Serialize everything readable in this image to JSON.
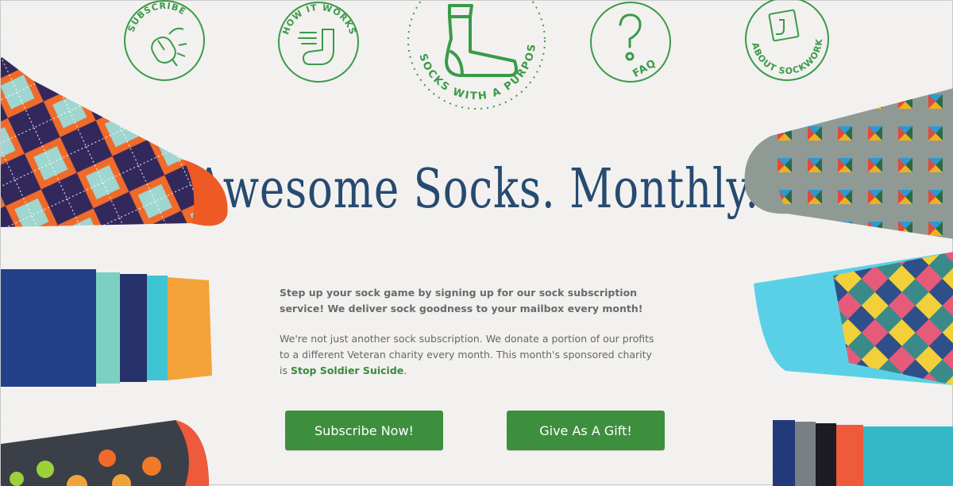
{
  "nav": {
    "subscribe": "SUBSCRIBE",
    "how_it_works": "HOW IT WORKS",
    "logo_tagline": "SOCKS WITH A PURPOSE",
    "faq": "FAQ",
    "about": "ABOUT SOCKWORK"
  },
  "hero": {
    "title": "Awesome Socks. Monthly.",
    "intro": "Step up your sock game by signing up for our sock subscription service! We deliver sock goodness to your mailbox every month!",
    "mission_before": "We're not just another sock subscription. We donate a portion of our profits to a different Veteran charity every month. This month's sponsored charity is ",
    "charity_link": "Stop Soldier Suicide",
    "mission_after": "."
  },
  "buttons": {
    "subscribe": "Subscribe Now!",
    "gift": "Give As A Gift!"
  },
  "colors": {
    "brand_green": "#3d8f3e",
    "title_navy": "#274a70",
    "background": "#f3f2f0"
  },
  "icons": [
    "mouse-icon",
    "sock-icon",
    "sock-logo-icon",
    "question-mark-icon",
    "book-icon"
  ]
}
